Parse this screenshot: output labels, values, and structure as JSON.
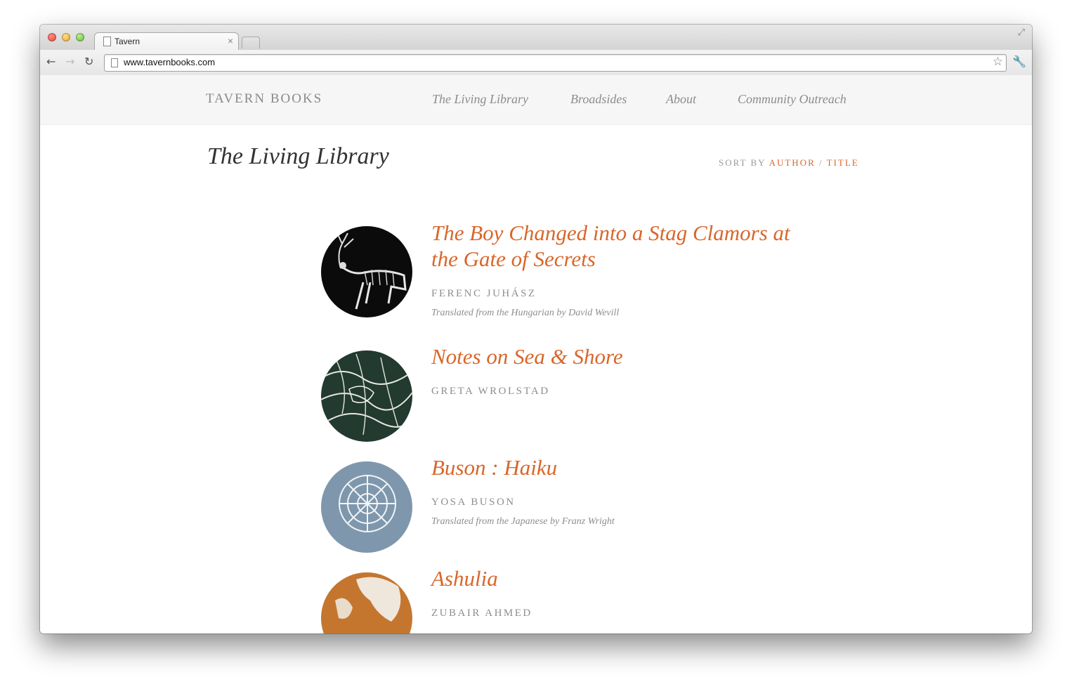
{
  "browser": {
    "tab_title": "Tavern",
    "tab_close": "×",
    "url": "www.tavernbooks.com",
    "back_icon": "arrow-left-icon",
    "forward_icon": "arrow-right-icon",
    "reload_icon": "reload-icon",
    "bookmark_icon": "star-icon",
    "menu_icon": "wrench-icon"
  },
  "site": {
    "logo": "TAVERN BOOKS",
    "nav": [
      {
        "label": "The Living Library"
      },
      {
        "label": "Broadsides"
      },
      {
        "label": "About"
      },
      {
        "label": "Community Outreach"
      }
    ]
  },
  "page": {
    "heading": "The Living Library",
    "sort_prefix": "SORT BY",
    "sort_author": "AUTHOR",
    "sort_separator": "/",
    "sort_title": "TITLE"
  },
  "books": [
    {
      "title": "The Boy Changed into a Stag Clamors at the Gate of Secrets",
      "author": "FERENC JUHÁSZ",
      "translation": "Translated from the Hungarian by David Wevill",
      "cover_color": "#0b0b0b"
    },
    {
      "title": "Notes on Sea & Shore",
      "author": "GRETA WROLSTAD",
      "translation": "",
      "cover_color": "#223a30"
    },
    {
      "title": "Buson : Haiku",
      "author": "YOSA BUSON",
      "translation": "Translated from the Japanese by Franz Wright",
      "cover_color": "#7e97ac"
    },
    {
      "title": "Ashulia",
      "author": "ZUBAIR AHMED",
      "translation": "",
      "cover_color": "#c4762f"
    }
  ],
  "colors": {
    "accent": "#d9662a",
    "muted_text": "#8e8e8e",
    "header_bg": "#f6f6f6"
  }
}
